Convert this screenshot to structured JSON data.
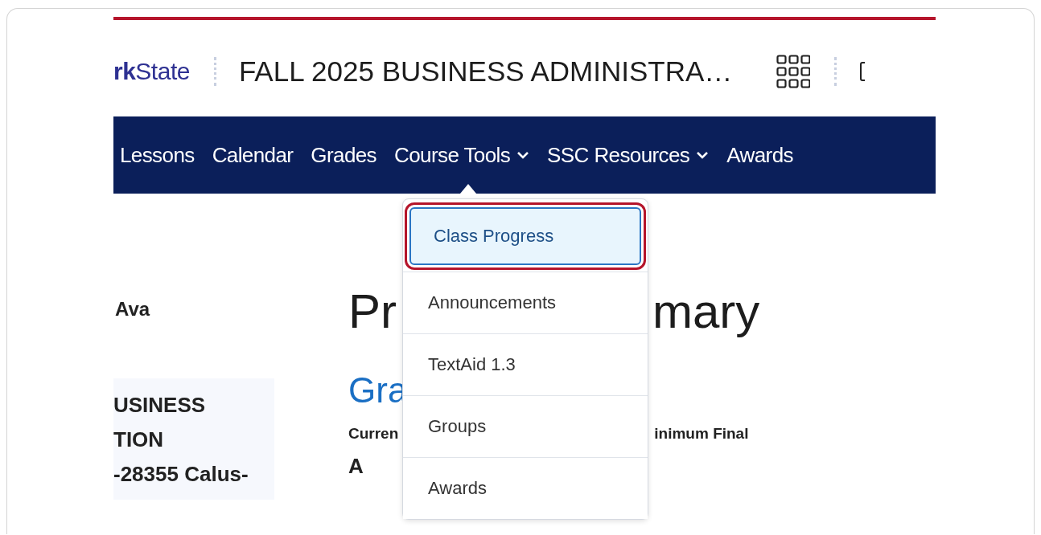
{
  "header": {
    "logo": "**rk**State",
    "course_title": "FALL 2025 BUSINESS ADMINISTRA…"
  },
  "nav": [
    {
      "label": "Lessons",
      "has_menu": false,
      "open": false
    },
    {
      "label": "Calendar",
      "has_menu": false,
      "open": false
    },
    {
      "label": "Grades",
      "has_menu": false,
      "open": false
    },
    {
      "label": "Course Tools",
      "has_menu": true,
      "open": true
    },
    {
      "label": "SSC Resources",
      "has_menu": true,
      "open": false
    },
    {
      "label": "Awards",
      "has_menu": false,
      "open": false
    }
  ],
  "dropdown": [
    {
      "label": "Class Progress",
      "selected": true
    },
    {
      "label": "Announcements",
      "selected": false
    },
    {
      "label": "TextAid 1.3",
      "selected": false
    },
    {
      "label": "Groups",
      "selected": false
    },
    {
      "label": "Awards",
      "selected": false
    }
  ],
  "sidebar": {
    "user_name": "Ava",
    "course_card_lines": [
      "USINESS",
      "TION",
      "-28355 Calus-"
    ]
  },
  "main": {
    "heading_left": "Pr",
    "heading_right": "mary",
    "section_left": "Gra",
    "label_left": "Curren",
    "label_right": "inimum Final",
    "grade_value": "A"
  }
}
